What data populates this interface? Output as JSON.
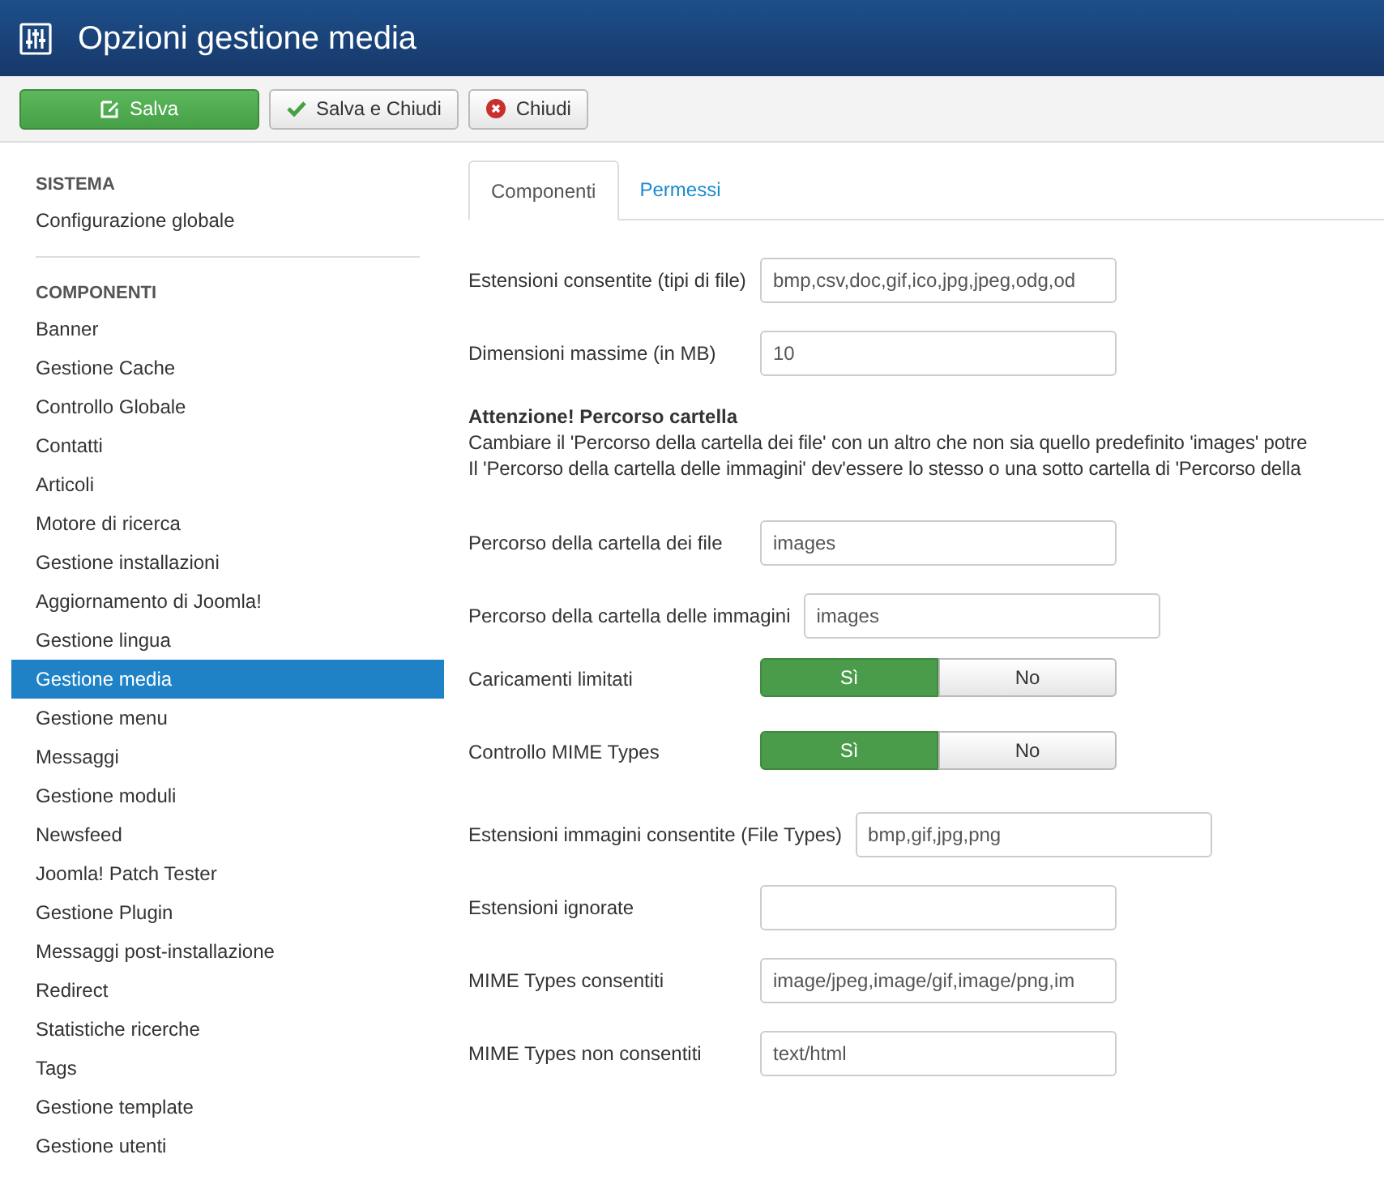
{
  "header": {
    "title": "Opzioni gestione media"
  },
  "toolbar": [
    {
      "label": "Salva",
      "kind": "primary"
    },
    {
      "label": "Salva e Chiudi",
      "kind": "check"
    },
    {
      "label": "Chiudi",
      "kind": "close"
    }
  ],
  "sidebar": {
    "sections": [
      {
        "heading": "SISTEMA",
        "items": [
          {
            "label": "Configurazione globale",
            "selected": false
          }
        ]
      },
      {
        "heading": "COMPONENTI",
        "items": [
          {
            "label": "Banner",
            "selected": false
          },
          {
            "label": "Gestione Cache",
            "selected": false
          },
          {
            "label": "Controllo Globale",
            "selected": false
          },
          {
            "label": "Contatti",
            "selected": false
          },
          {
            "label": "Articoli",
            "selected": false
          },
          {
            "label": "Motore di ricerca",
            "selected": false
          },
          {
            "label": "Gestione installazioni",
            "selected": false
          },
          {
            "label": "Aggiornamento di Joomla!",
            "selected": false
          },
          {
            "label": "Gestione lingua",
            "selected": false
          },
          {
            "label": "Gestione media",
            "selected": true
          },
          {
            "label": "Gestione menu",
            "selected": false
          },
          {
            "label": "Messaggi",
            "selected": false
          },
          {
            "label": "Gestione moduli",
            "selected": false
          },
          {
            "label": "Newsfeed",
            "selected": false
          },
          {
            "label": "Joomla! Patch Tester",
            "selected": false
          },
          {
            "label": "Gestione Plugin",
            "selected": false
          },
          {
            "label": "Messaggi post-installazione",
            "selected": false
          },
          {
            "label": "Redirect",
            "selected": false
          },
          {
            "label": "Statistiche ricerche",
            "selected": false
          },
          {
            "label": "Tags",
            "selected": false
          },
          {
            "label": "Gestione template",
            "selected": false
          },
          {
            "label": "Gestione utenti",
            "selected": false
          }
        ]
      }
    ]
  },
  "tabs": [
    {
      "label": "Componenti",
      "selected": true
    },
    {
      "label": "Permessi",
      "selected": false
    }
  ],
  "fields": [
    {
      "kind": "text",
      "label": "Estensioni consentite (tipi di file)",
      "value": "bmp,csv,doc,gif,ico,jpg,jpeg,odg,od"
    },
    {
      "kind": "text",
      "label": "Dimensioni massime (in MB)",
      "value": "10"
    },
    {
      "kind": "note",
      "title": "Attenzione! Percorso cartella",
      "lines": [
        "Cambiare il 'Percorso della cartella dei file' con un altro che non sia quello predefinito 'images' potre",
        "Il 'Percorso della cartella delle immagini' dev'essere lo stesso o una sotto cartella di 'Percorso della"
      ]
    },
    {
      "kind": "text",
      "label": "Percorso della cartella dei file",
      "value": "images"
    },
    {
      "kind": "text",
      "label": "Percorso della cartella delle immagini",
      "value": "images"
    },
    {
      "kind": "toggle",
      "label": "Caricamenti limitati",
      "options": [
        {
          "label": "Sì",
          "selected": true
        },
        {
          "label": "No",
          "selected": false
        }
      ]
    },
    {
      "kind": "toggle",
      "label": "Controllo MIME Types",
      "options": [
        {
          "label": "Sì",
          "selected": true
        },
        {
          "label": "No",
          "selected": false
        }
      ]
    },
    {
      "kind": "text",
      "label": "Estensioni immagini consentite (File Types)",
      "value": "bmp,gif,jpg,png"
    },
    {
      "kind": "text",
      "label": "Estensioni ignorate"
    },
    {
      "kind": "text",
      "label": "MIME Types consentiti",
      "value": "image/jpeg,image/gif,image/png,im"
    },
    {
      "kind": "text",
      "label": "MIME Types non consentiti",
      "value": "text/html"
    }
  ]
}
